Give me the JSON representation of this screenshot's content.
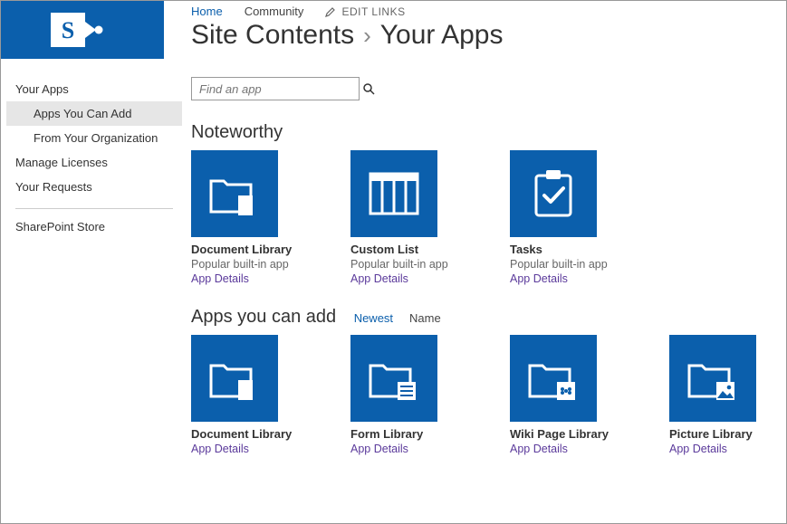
{
  "colors": {
    "brand": "#0b5fac",
    "linkpurple": "#5b3a9b"
  },
  "nav": {
    "home": "Home",
    "community": "Community",
    "edit_links": "EDIT LINKS"
  },
  "title": {
    "breadcrumb": "Site Contents",
    "page": "Your Apps"
  },
  "sidebar": {
    "your_apps": "Your Apps",
    "apps_you_can_add": "Apps You Can Add",
    "from_org": "From Your Organization",
    "manage_licenses": "Manage Licenses",
    "your_requests": "Your Requests",
    "store": "SharePoint Store"
  },
  "search": {
    "placeholder": "Find an app"
  },
  "sections": {
    "noteworthy": "Noteworthy",
    "apps_you_can_add": "Apps you can add"
  },
  "sort": {
    "newest": "Newest",
    "name": "Name"
  },
  "noteworthy": [
    {
      "title": "Document Library",
      "sub": "Popular built-in app",
      "details": "App Details",
      "icon": "document-library"
    },
    {
      "title": "Custom List",
      "sub": "Popular built-in app",
      "details": "App Details",
      "icon": "custom-list"
    },
    {
      "title": "Tasks",
      "sub": "Popular built-in app",
      "details": "App Details",
      "icon": "tasks"
    }
  ],
  "addable": [
    {
      "title": "Document Library",
      "details": "App Details",
      "icon": "document-library"
    },
    {
      "title": "Form Library",
      "details": "App Details",
      "icon": "form-library"
    },
    {
      "title": "Wiki Page Library",
      "details": "App Details",
      "icon": "wiki-library"
    },
    {
      "title": "Picture Library",
      "details": "App Details",
      "icon": "picture-library"
    }
  ]
}
